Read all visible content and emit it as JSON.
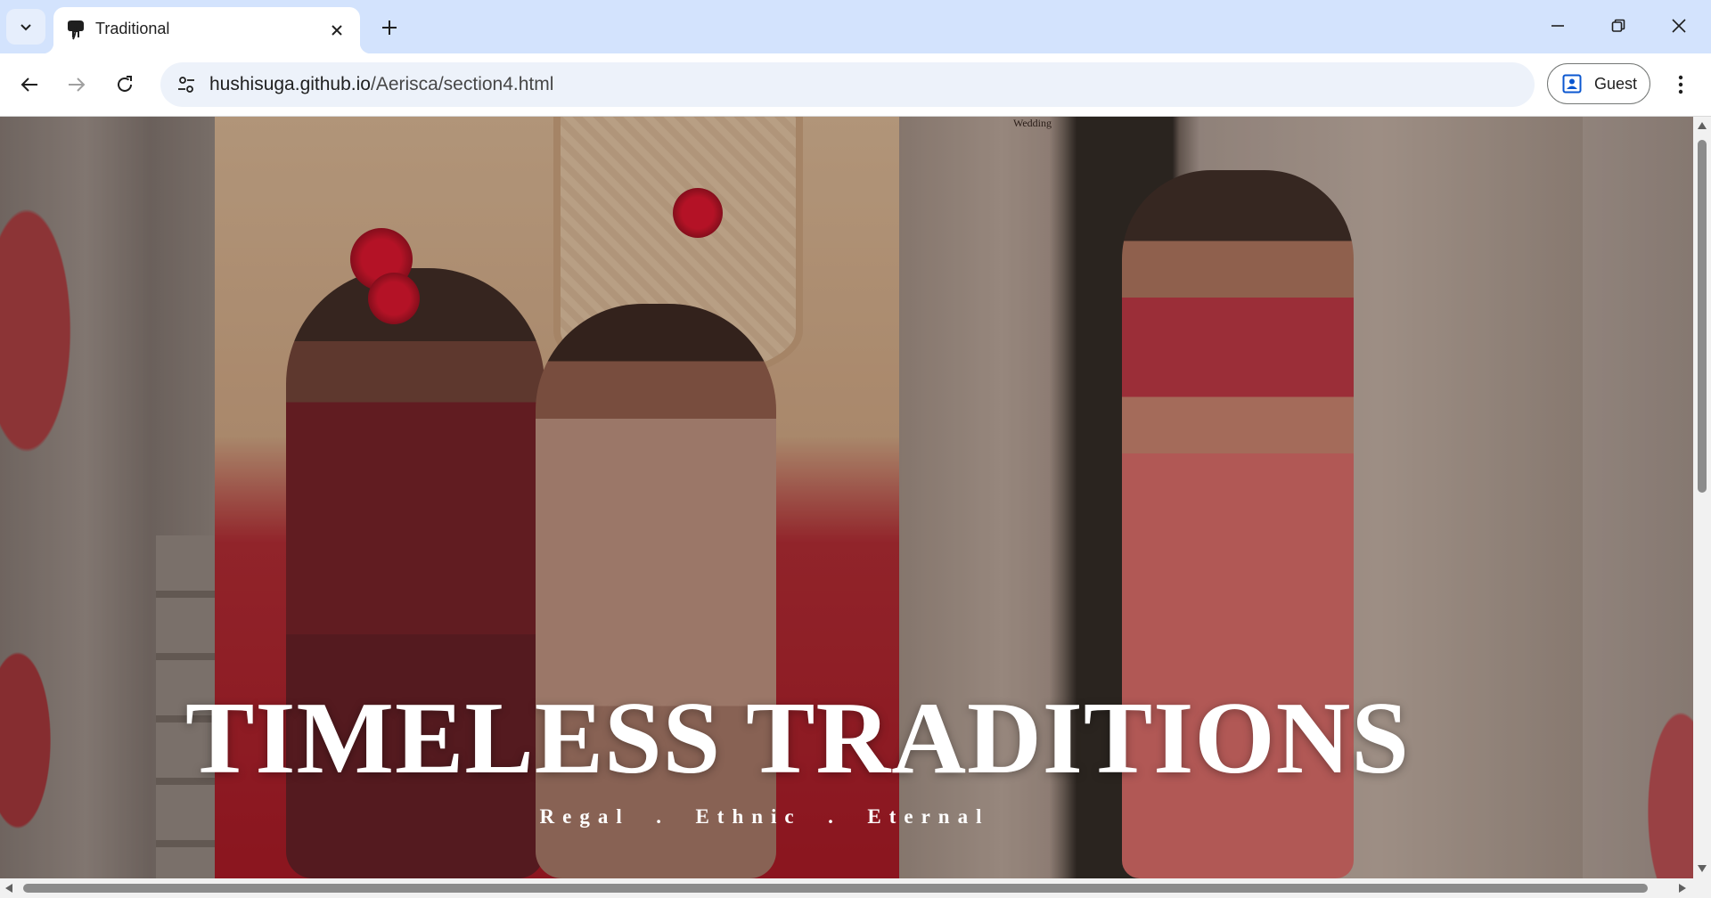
{
  "tab": {
    "title": "Traditional",
    "favicon": "elephant-icon"
  },
  "omnibox": {
    "host": "hushisuga.github.io",
    "path": "/Aerisca/section4.html"
  },
  "profile": {
    "label": "Guest"
  },
  "hero": {
    "title": "TIMELESS TRADITIONS",
    "subtitle": "Regal  .  Ethnic  .  Eternal",
    "logo_fragment": "Wedding"
  },
  "colors": {
    "tabstrip_bg": "#d3e3fd",
    "omnibox_bg": "#edf2fa",
    "hero_text": "#ffffff"
  }
}
